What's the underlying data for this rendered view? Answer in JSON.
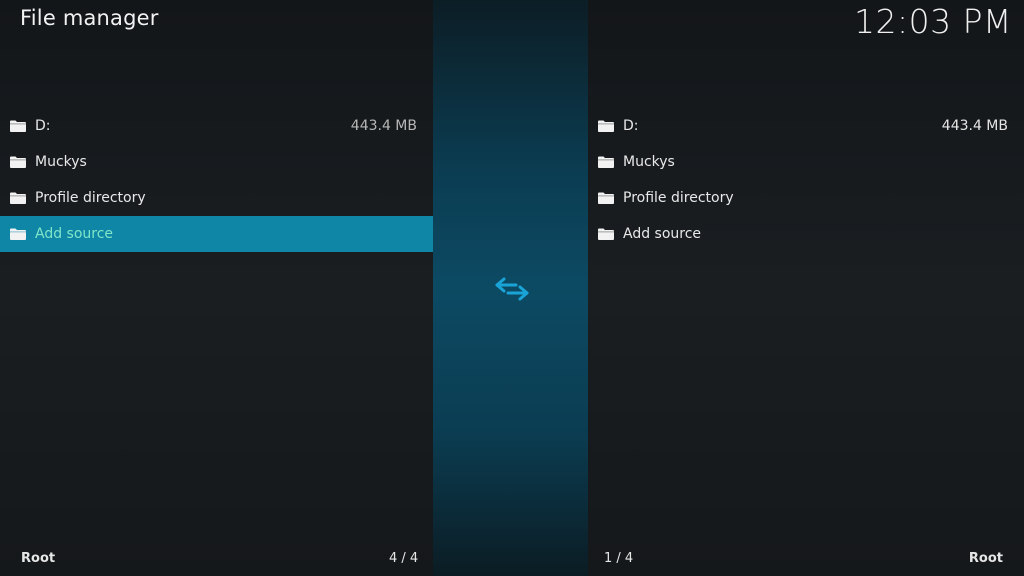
{
  "header": {
    "title": "File manager",
    "clock": "12:03 PM"
  },
  "left_pane": {
    "items": [
      {
        "label": "D:",
        "size": "443.4 MB"
      },
      {
        "label": "Muckys",
        "size": ""
      },
      {
        "label": "Profile directory",
        "size": ""
      },
      {
        "label": "Add source",
        "size": ""
      }
    ],
    "focused_index": 3,
    "footer_path": "Root",
    "footer_count": "4 / 4"
  },
  "right_pane": {
    "items": [
      {
        "label": "D:",
        "size": "443.4 MB"
      },
      {
        "label": "Muckys",
        "size": ""
      },
      {
        "label": "Profile directory",
        "size": ""
      },
      {
        "label": "Add source",
        "size": ""
      }
    ],
    "footer_path": "Root",
    "footer_count": "1 / 4"
  },
  "icons": {
    "folder": "folder-icon",
    "swap": "swap-arrows-icon"
  },
  "colors": {
    "focus_bg": "#0f86a6",
    "focus_text": "#7fe6c8",
    "swap_icon": "#1aa3d6"
  }
}
